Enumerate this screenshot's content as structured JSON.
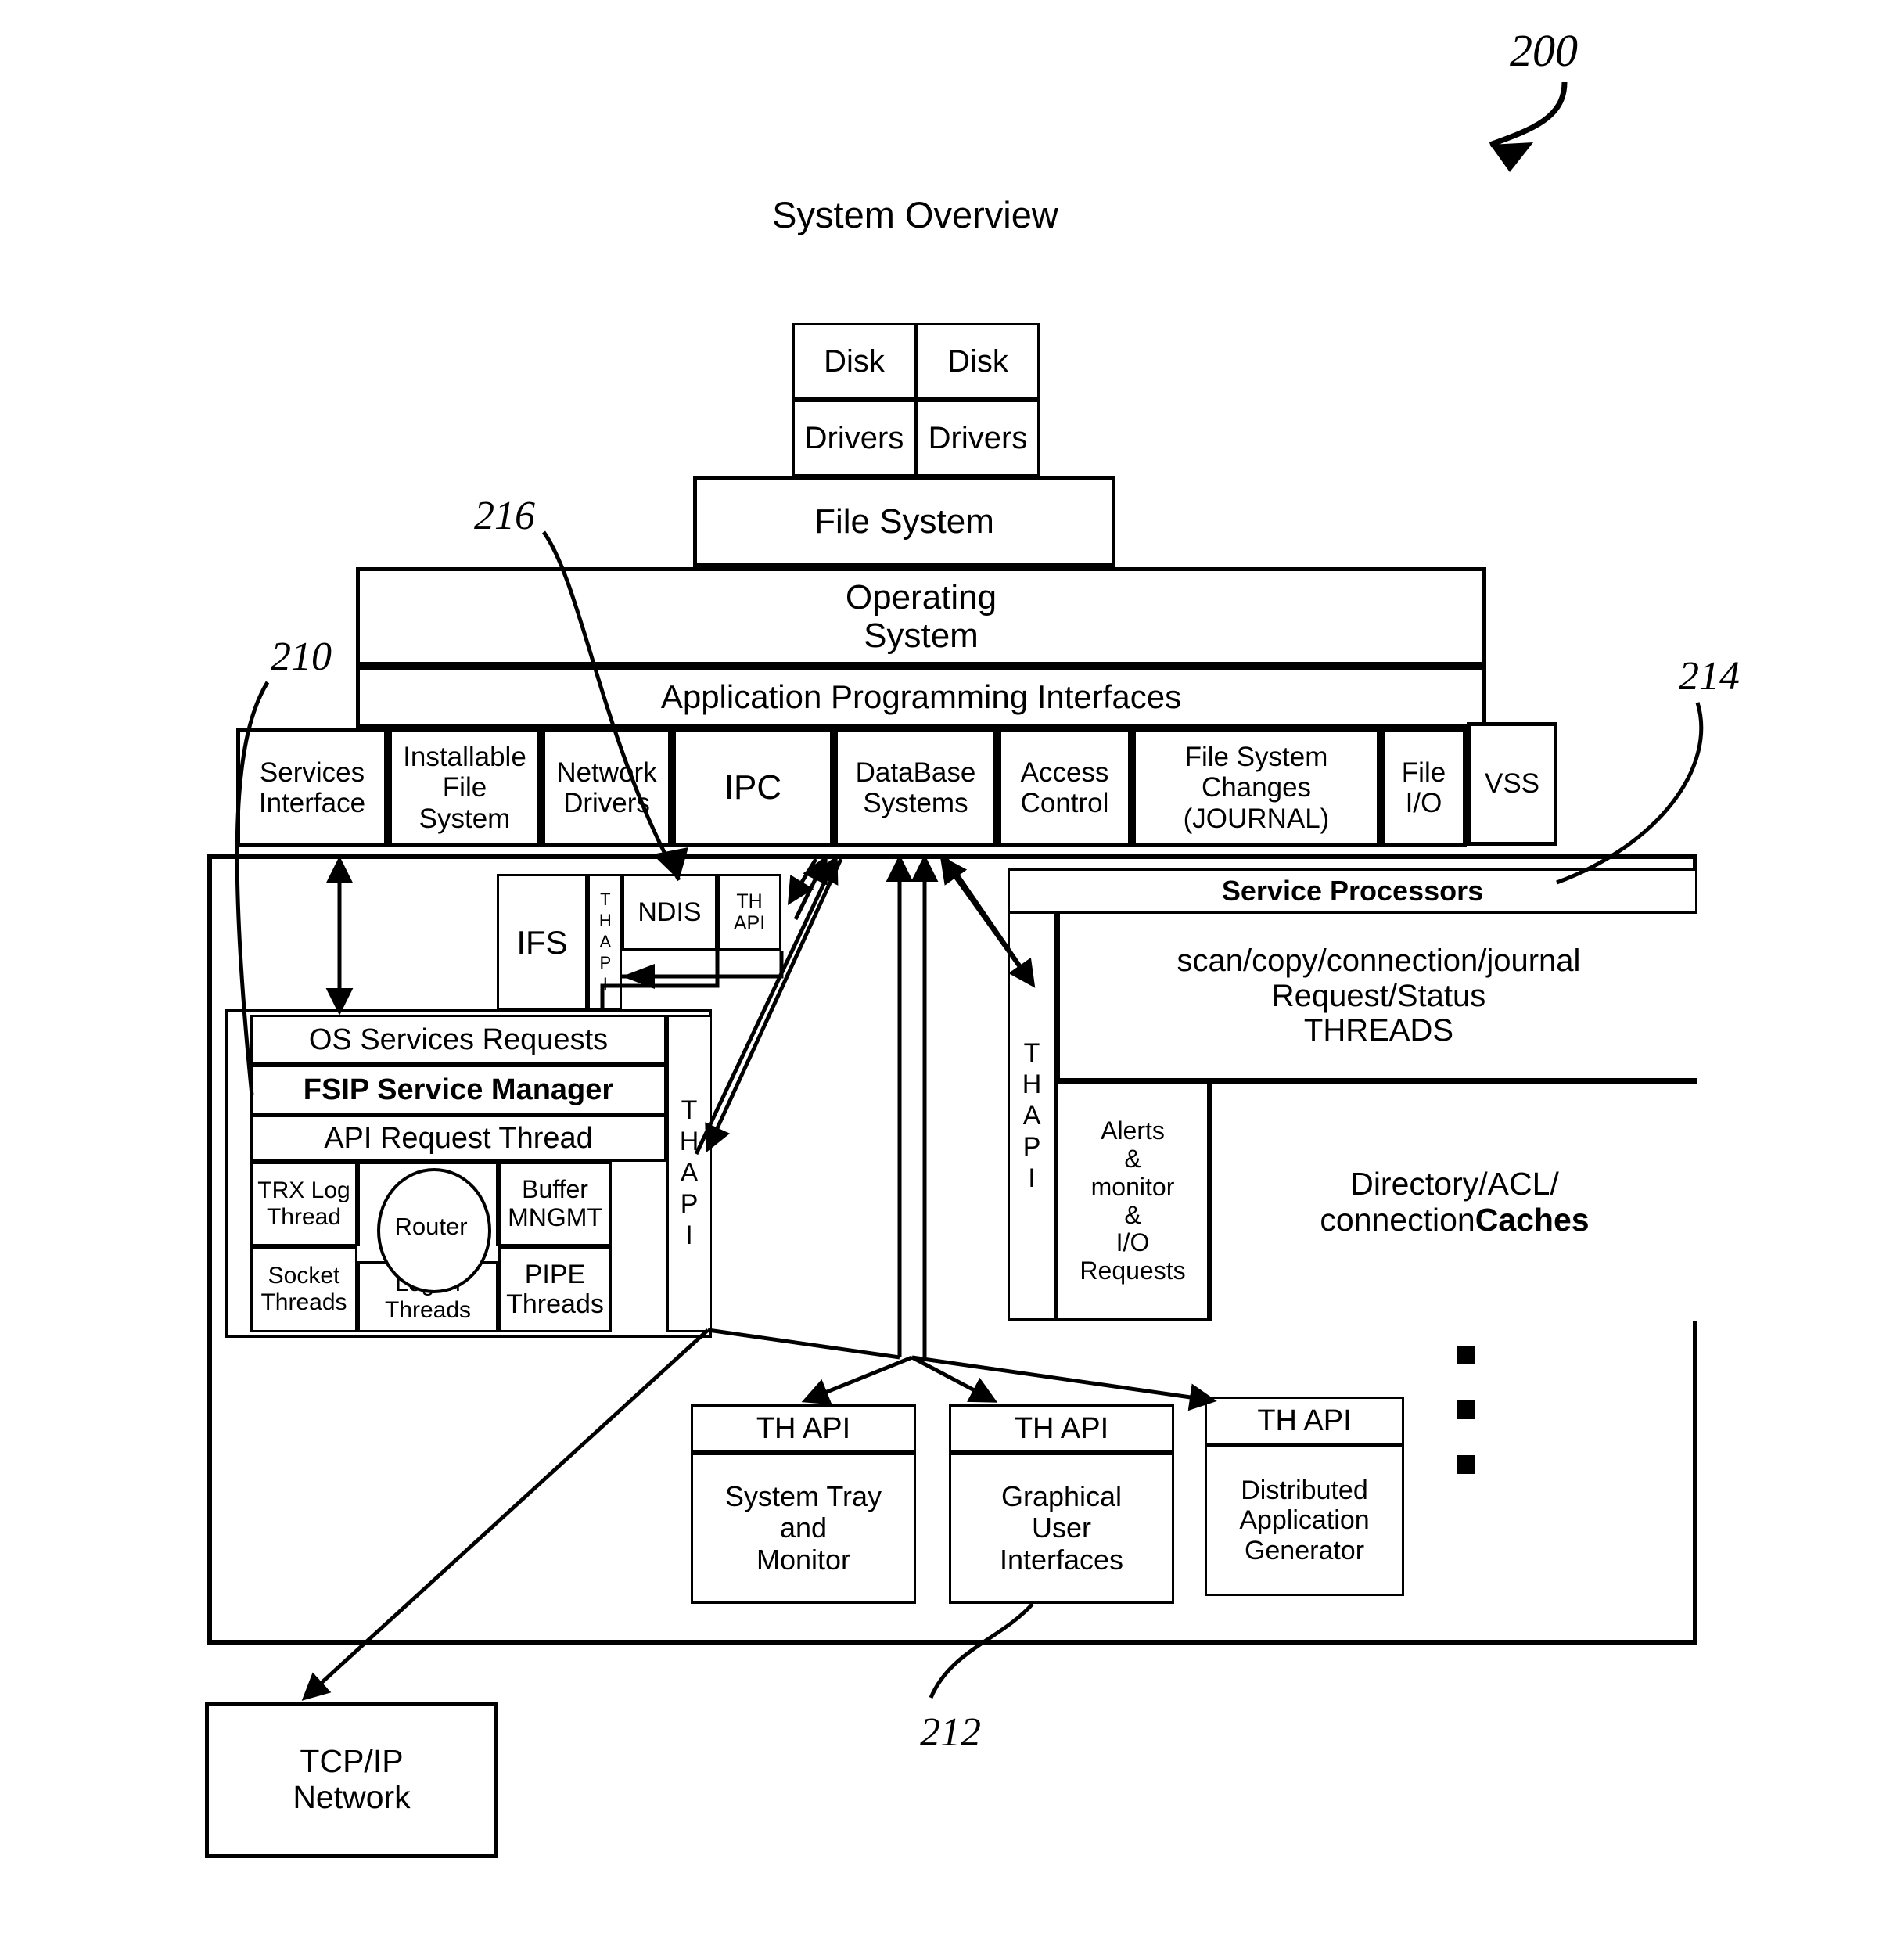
{
  "figure": {
    "number": "200",
    "title": "System Overview",
    "ref_210": "210",
    "ref_212": "212",
    "ref_214": "214",
    "ref_216": "216"
  },
  "stack": {
    "disk_left": "Disk",
    "disk_right": "Disk",
    "drivers_left": "Drivers",
    "drivers_right": "Drivers",
    "file_system": "File System",
    "operating_system_line1": "Operating",
    "operating_system_line2": "System",
    "apis_band": "Application Programming Interfaces"
  },
  "api_columns": [
    {
      "label_line1": "Services",
      "label_line2": "Interface",
      "label_line3": ""
    },
    {
      "label_line1": "Installable",
      "label_line2": "File",
      "label_line3": "System"
    },
    {
      "label_line1": "Network",
      "label_line2": "Drivers",
      "label_line3": ""
    },
    {
      "label_line1": "IPC",
      "label_line2": "",
      "label_line3": ""
    },
    {
      "label_line1": "DataBase",
      "label_line2": "Systems",
      "label_line3": ""
    },
    {
      "label_line1": "Access",
      "label_line2": "Control",
      "label_line3": ""
    },
    {
      "label_line1": "File System",
      "label_line2": "Changes",
      "label_line3": "(JOURNAL)"
    },
    {
      "label_line1": "File",
      "label_line2": "I/O",
      "label_line3": ""
    },
    {
      "label_line1": "VSS",
      "label_line2": "",
      "label_line3": ""
    }
  ],
  "ifs_group": {
    "ifs": "IFS",
    "ifs_thapi": "THAPI",
    "ndis": "NDIS",
    "ndis_thapi_line1": "TH",
    "ndis_thapi_line2": "API"
  },
  "service_manager": {
    "os_services_requests": "OS Services Requests",
    "fsip_service_manager": "FSIP Service Manager",
    "api_request_thread": "API Request Thread",
    "trx_log_thread_line1": "TRX Log",
    "trx_log_thread_line2": "Thread",
    "router": "Router",
    "buffer_mngmt_line1": "Buffer",
    "buffer_mngmt_line2": "MNGMT",
    "socket_threads_line1": "Socket",
    "socket_threads_line2": "Threads",
    "logon_threads_line1": "Logon",
    "logon_threads_line2": "Threads",
    "pipe_threads_line1": "PIPE",
    "pipe_threads_line2": "Threads",
    "side_thapi": "THAPI"
  },
  "service_processors": {
    "header": "Service Processors",
    "side_thapi": "THAPI",
    "threads_line1": "scan/copy/connection/journal",
    "threads_line2": "Request/Status",
    "threads_line3": "THREADS",
    "alerts_line1": "Alerts",
    "alerts_line2": "&",
    "alerts_line3": "monitor",
    "alerts_line4": "&",
    "alerts_line5": "I/O",
    "alerts_line6": "Requests",
    "caches_line1": "Directory/ACL/",
    "caches_line2a": "connection ",
    "caches_line2b": "Caches"
  },
  "client_apps": [
    {
      "header": "TH API",
      "body_line1": "System Tray",
      "body_line2": "and",
      "body_line3": "Monitor"
    },
    {
      "header": "TH API",
      "body_line1": "Graphical",
      "body_line2": "User",
      "body_line3": "Interfaces"
    },
    {
      "header": "TH API",
      "body_line1": "Distributed",
      "body_line2": "Application",
      "body_line3": "Generator"
    }
  ],
  "network": {
    "line1": "TCP/IP",
    "line2": "Network"
  },
  "colors": {
    "ink": "#000000",
    "paper": "#ffffff"
  }
}
